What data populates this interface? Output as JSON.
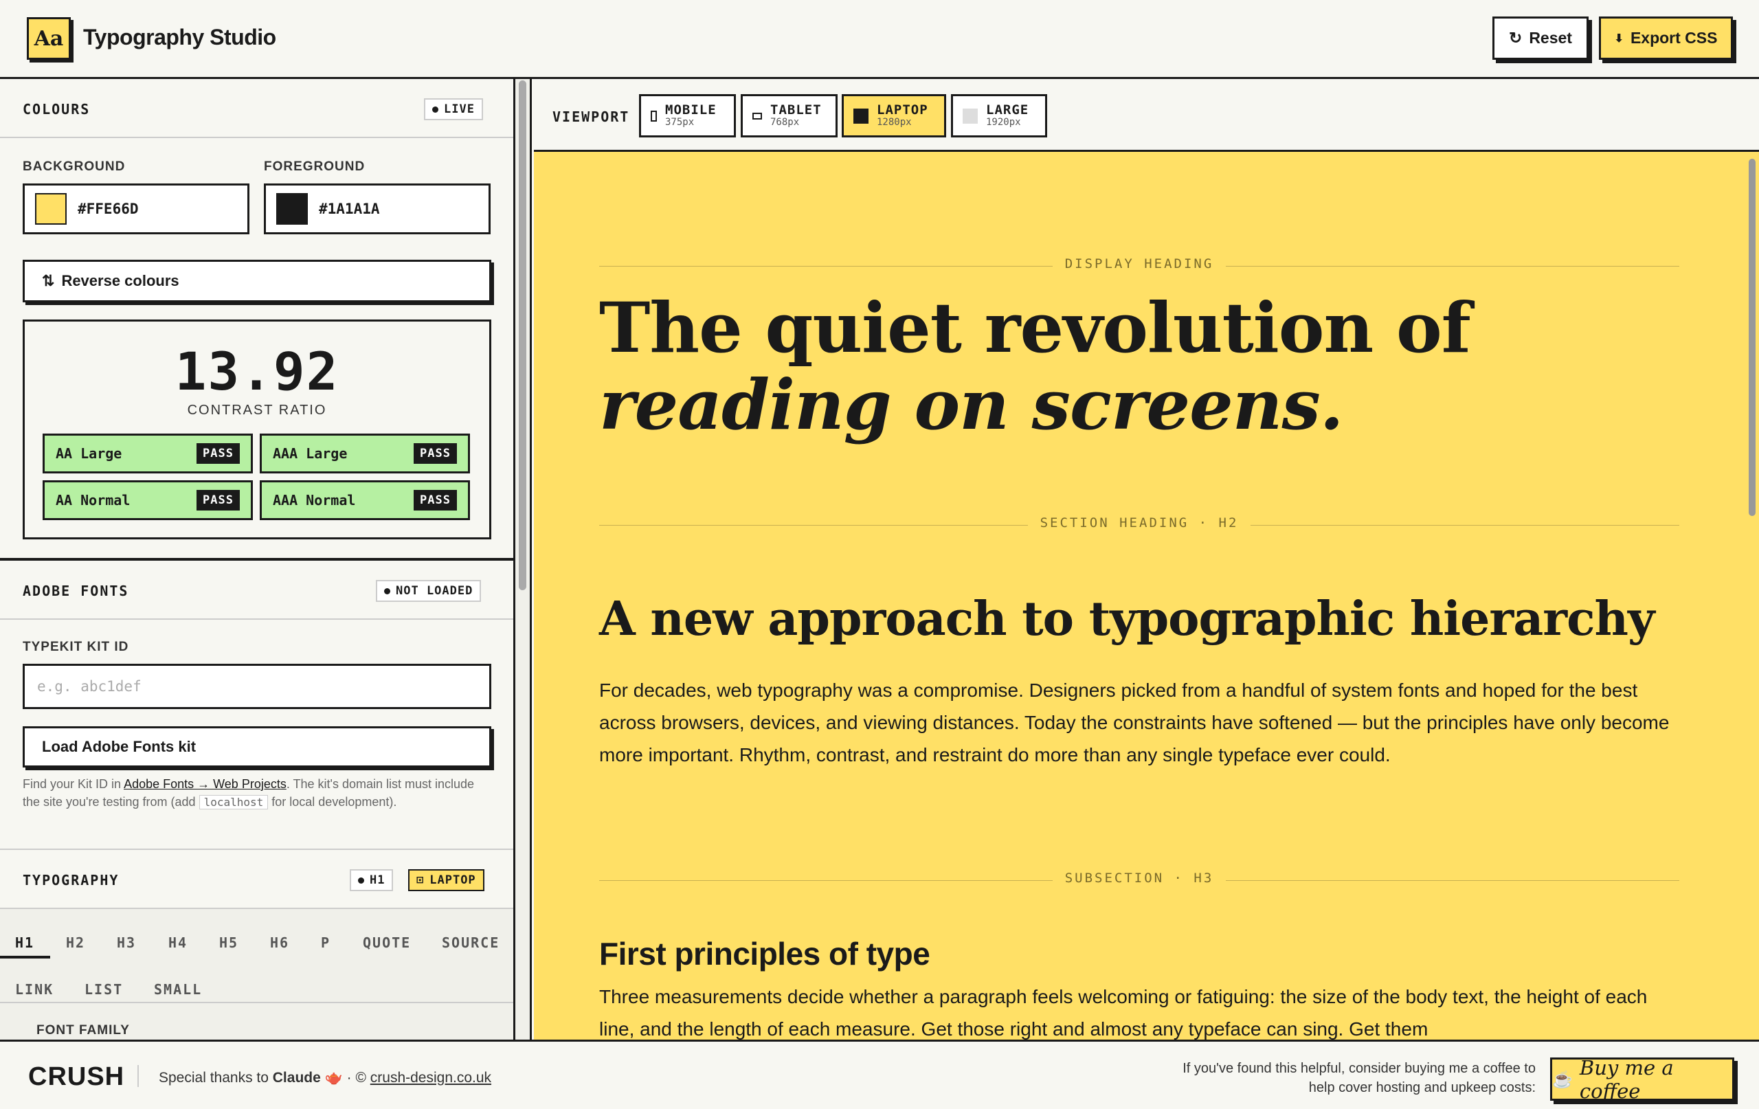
{
  "header": {
    "logo": "Aa",
    "title": "Typography Studio",
    "reset_label": "Reset",
    "reset_icon": "↻",
    "export_label": "Export CSS",
    "export_icon": "⬇"
  },
  "colours": {
    "title": "COLOURS",
    "status": "LIVE",
    "background_label": "BACKGROUND",
    "background_value": "#FFE66D",
    "foreground_label": "FOREGROUND",
    "foreground_value": "#1A1A1A",
    "reverse_label": "Reverse colours",
    "reverse_icon": "⇅"
  },
  "contrast": {
    "ratio": "13.92",
    "label": "CONTRAST RATIO",
    "checks": [
      {
        "name": "AA Large",
        "result": "PASS"
      },
      {
        "name": "AAA Large",
        "result": "PASS"
      },
      {
        "name": "AA Normal",
        "result": "PASS"
      },
      {
        "name": "AAA Normal",
        "result": "PASS"
      }
    ]
  },
  "adobe": {
    "title": "ADOBE FONTS",
    "status": "NOT LOADED",
    "kit_label": "TYPEKIT KIT ID",
    "kit_placeholder": "e.g. abc1def",
    "load_label": "Load Adobe Fonts kit",
    "hint_a": "Find your Kit ID in ",
    "hint_link": "Adobe Fonts → Web Projects",
    "hint_b": ". The kit's domain list must include the site you're testing from (add ",
    "hint_code": "localhost",
    "hint_c": " for local development)."
  },
  "typography": {
    "title": "TYPOGRAPHY",
    "element_pill": "H1",
    "viewport_pill": "LAPTOP",
    "tabs": [
      "H1",
      "H2",
      "H3",
      "H4",
      "H5",
      "H6",
      "P",
      "QUOTE",
      "SOURCE",
      "LINK",
      "LIST",
      "SMALL"
    ],
    "font_family_label": "FONT FAMILY"
  },
  "viewport": {
    "label": "VIEWPORT",
    "options": [
      {
        "name": "MOBILE",
        "size": "375px"
      },
      {
        "name": "TABLET",
        "size": "768px"
      },
      {
        "name": "LAPTOP",
        "size": "1280px"
      },
      {
        "name": "LARGE",
        "size": "1920px"
      }
    ],
    "active": "LAPTOP"
  },
  "preview": {
    "display_label": "DISPLAY HEADING",
    "display_heading_a": "The quiet revolution of ",
    "display_heading_b": "reading on screens.",
    "section_label": "SECTION HEADING · H2",
    "h2": "A new approach to typographic hierarchy",
    "para1": "For decades, web typography was a compromise. Designers picked from a handful of system fonts and hoped for the best across browsers, devices, and viewing distances. Today the constraints have softened — but the principles have only become more important. Rhythm, contrast, and restraint do more than any single typeface ever could.",
    "subsection_label": "SUBSECTION · H3",
    "h3": "First principles of type",
    "para2": "Three measurements decide whether a paragraph feels welcoming or fatiguing: the size of the body text, the height of each line, and the length of each measure. Get those right and almost any typeface can sing. Get them"
  },
  "footer": {
    "brand": "CRUSH",
    "thanks_a": "Special thanks to ",
    "thanks_name": "Claude",
    "thanks_emoji": "🫖",
    "sep": " · © ",
    "site": "crush-design.co.uk",
    "coffee_text": "If you've found this helpful, consider buying me a coffee to help cover hosting and upkeep costs:",
    "coffee_icon": "☕",
    "coffee_label": "Buy me a coffee"
  },
  "colors": {
    "accent": "#ffe066",
    "ink": "#1a1a1a",
    "pass": "#b6f0a2",
    "paper": "#f7f7f2"
  }
}
